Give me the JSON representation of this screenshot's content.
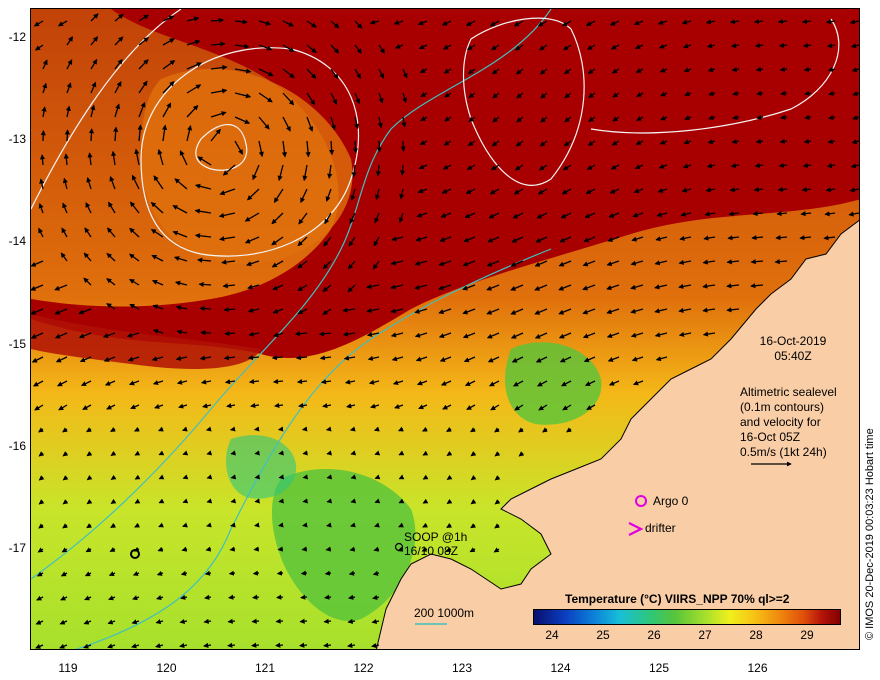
{
  "map": {
    "y_ticks": [
      {
        "label": "-12",
        "lat": -12
      },
      {
        "label": "-13",
        "lat": -13
      },
      {
        "label": "-14",
        "lat": -14
      },
      {
        "label": "-15",
        "lat": -15
      },
      {
        "label": "-16",
        "lat": -16
      },
      {
        "label": "-17",
        "lat": -17
      }
    ],
    "x_ticks": [
      {
        "label": "119",
        "lon": 119
      },
      {
        "label": "120",
        "lon": 120
      },
      {
        "label": "121",
        "lon": 121
      },
      {
        "label": "122",
        "lon": 122
      },
      {
        "label": "123",
        "lon": 123
      },
      {
        "label": "124",
        "lon": 124
      },
      {
        "label": "125",
        "lon": 125
      },
      {
        "label": "126",
        "lon": 126
      }
    ],
    "date_line1": "16-Oct-2019",
    "date_line2": "05:40Z",
    "alt_lines": [
      "Altimetric sealevel",
      "(0.1m contours)",
      "and velocity for",
      "16-Oct 05Z",
      "0.5m/s (1kt 24h)"
    ],
    "argo_label": "Argo 0",
    "drifter_label": "drifter",
    "soop_line1": "SOOP @1h",
    "soop_line2": "16/10 08Z",
    "bathy_label": "200  1000m",
    "colorbar_title": "Temperature (°C) VIIRS_NPP 70% ql>=2",
    "colorbar_ticks": [
      "24",
      "25",
      "26",
      "27",
      "28",
      "29"
    ],
    "credit": "© IMOS 20-Dec-2019 00:03:23 Hobart time",
    "colors": {
      "land": "#f9cda5",
      "warm": "#a80000",
      "mid": "#ef8a0e",
      "cool": "#a6e02c",
      "bathy": "#40c0c0",
      "argo": "#e000e0"
    }
  }
}
